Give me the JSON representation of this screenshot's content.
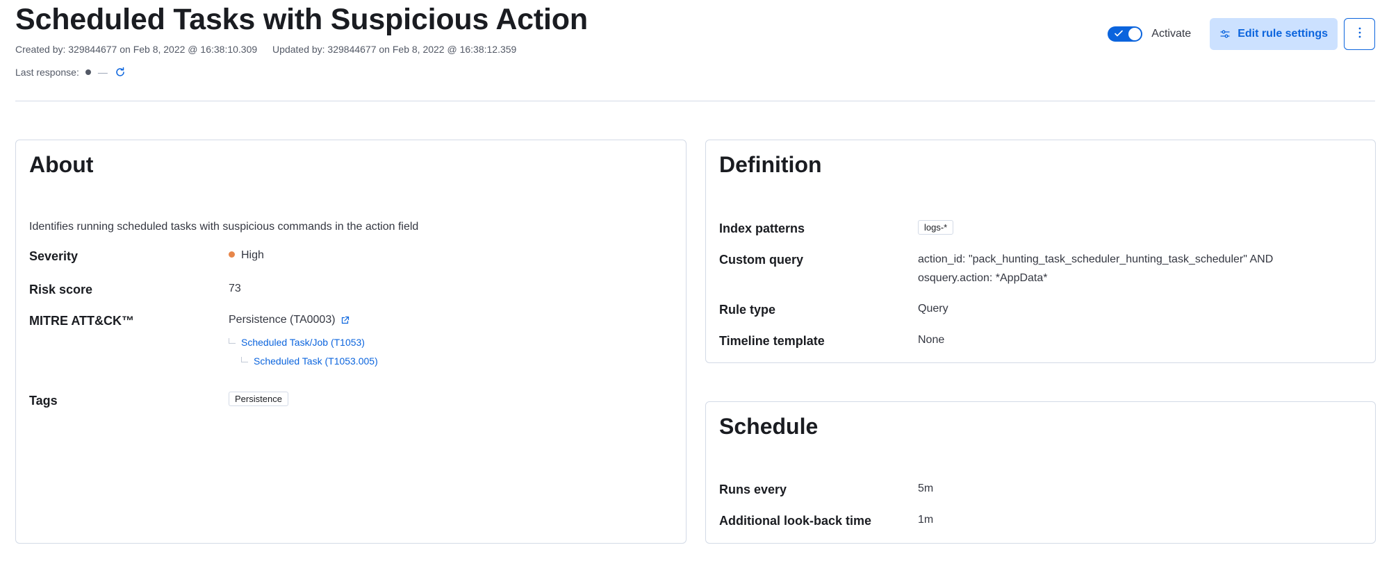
{
  "header": {
    "title": "Scheduled Tasks with Suspicious Action",
    "created": "Created by: 329844677 on Feb 8, 2022 @ 16:38:10.309",
    "updated": "Updated by: 329844677 on Feb 8, 2022 @ 16:38:12.359",
    "last_response_label": "Last response:",
    "last_response_value": "—",
    "activate_label": "Activate",
    "activate_on": true,
    "edit_button": "Edit rule settings"
  },
  "about": {
    "title": "About",
    "description": "Identifies running scheduled tasks with suspicious commands in the action field",
    "severity_label": "Severity",
    "severity_value": "High",
    "severity_color": "#e7864a",
    "risk_label": "Risk score",
    "risk_value": "73",
    "mitre_label": "MITRE ATT&CK™",
    "tactic": "Persistence (TA0003)",
    "technique": "Scheduled Task/Job (T1053)",
    "subtechnique": "Scheduled Task (T1053.005)",
    "tags_label": "Tags",
    "tags": [
      "Persistence"
    ]
  },
  "definition": {
    "title": "Definition",
    "index_label": "Index patterns",
    "index_value": "logs-*",
    "query_label": "Custom query",
    "query_line1": "action_id: \"pack_hunting_task_scheduler_hunting_task_scheduler\" AND",
    "query_line2": "osquery.action: *AppData*",
    "rule_type_label": "Rule type",
    "rule_type_value": "Query",
    "timeline_label": "Timeline template",
    "timeline_value": "None"
  },
  "schedule": {
    "title": "Schedule",
    "runs_label": "Runs every",
    "runs_value": "5m",
    "lookback_label": "Additional look-back time",
    "lookback_value": "1m"
  },
  "icons": {
    "refresh": "refresh-icon",
    "toggle_check": "check-icon",
    "edit": "settings-sliders-icon",
    "more": "vertical-dots-icon",
    "external_link": "external-link-icon"
  },
  "colors": {
    "accent": "#0b64dd",
    "accent_light": "#cce1ff",
    "border": "#d3dae6"
  }
}
